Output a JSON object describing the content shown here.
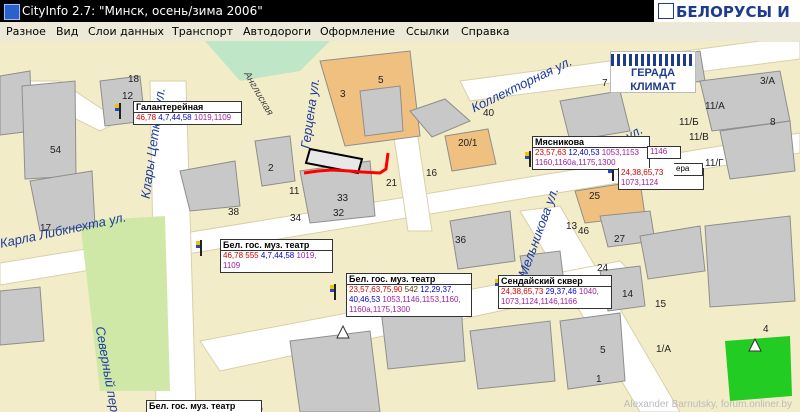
{
  "titlebar": {
    "title": "CityInfo 2.7: \"Минск, осень/зима 2006\""
  },
  "brand": {
    "text": "БЕЛОРУСЫ И"
  },
  "menu": [
    "Разное",
    "Вид",
    "Слои данных",
    "Транспорт",
    "Автодороги",
    "Оформление",
    "Ссылки",
    "Справка"
  ],
  "ad": {
    "line1": "ГЕРАДА",
    "line2": "КЛИМАТ"
  },
  "streets": {
    "gertsena": "Герцена ул.",
    "kollektornaya": "Коллекторная ул.",
    "klara": "Клары Цеткин ул.",
    "karla": "Карла Либкнехта ул.",
    "severny": "Северный пер.",
    "mel": "Мельникова ул.",
    "gi": "гига ул.",
    "anglia": "Англиская",
    "kra": "Кра"
  },
  "buildings": [
    "18",
    "12",
    "3",
    "5",
    "54",
    "40",
    "2",
    "20/1",
    "16",
    "11",
    "21",
    "25",
    "36",
    "33",
    "34",
    "32",
    "17",
    "38",
    "46",
    "27",
    "24",
    "14",
    "4",
    "11/Б",
    "11/В",
    "11/Г",
    "11/А",
    "3/А",
    "8",
    "1/А",
    "7",
    "13",
    "15",
    "5",
    "5",
    "1"
  ],
  "popups": {
    "galant": {
      "name": "Галантерейная",
      "r": "46,78",
      "b": "4,7,44,58",
      "m": "1019,1109"
    },
    "myasn": {
      "name": "Мясникова",
      "r": "23,57,63",
      "b": "12,40,53",
      "m1": "1053,1153",
      "m2": "1160,1160а,1175,1300",
      "extra": "1146"
    },
    "myasn2": {
      "r": "24,38,65,73",
      "m": "1073,1124",
      "extra": "ера"
    },
    "bel1": {
      "name": "Бел. гос. муз. театр",
      "r": "46,78",
      "r2": "555",
      "b": "4,7,44,58",
      "m": "1019,",
      "m2": "1109"
    },
    "bel2": {
      "name": "Бел. гос. муз. театр",
      "r": "23,57,63,75,90",
      "k": "542",
      "b": "12,29,37,",
      "b2": "40,46,53",
      "m": "1053,1146,1153,1160,",
      "m2": "1160а,1175,1300"
    },
    "send": {
      "name": "Сендайский сквер",
      "r": "24,38,65,73",
      "b": "29,37,46",
      "m": "1040,",
      "m2": "1073,1124,1146,1166"
    },
    "bel3": {
      "name": "Бел. гос. муз. театр"
    }
  },
  "watermark": "Alexander Barnutsky, forum.onliner.by",
  "colors": {
    "land": "#f3ecc8",
    "building": "#c8c8c8",
    "road": "#ffffff",
    "park": "#cfe8a8",
    "green_lot": "#22cc22",
    "route": "#ff0000"
  }
}
